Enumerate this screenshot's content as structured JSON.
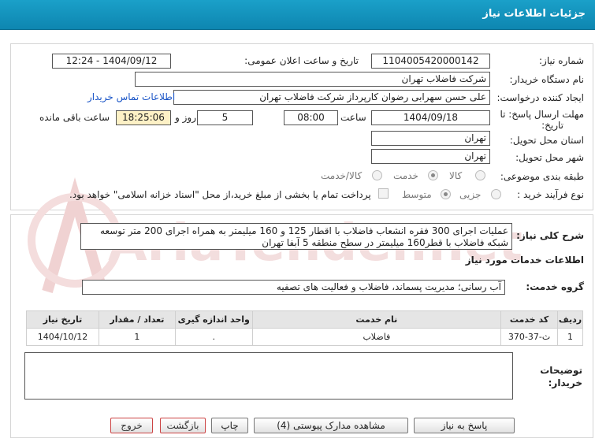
{
  "header": {
    "title": "جزئیات اطلاعات نیاز"
  },
  "form": {
    "need_number_label": "شماره نیاز:",
    "need_number": "1104005420000142",
    "announce_label": "تاریخ و ساعت اعلان عمومی:",
    "announce_value": "1404/09/12 - 12:24",
    "buyer_org_label": "نام دستگاه خریدار:",
    "buyer_org": "شرکت فاضلاب تهران",
    "creator_label": "ایجاد کننده درخواست:",
    "creator": "علی حسن  سهرابی رضوان کارپرداز شرکت فاضلاب تهران",
    "contact_link": "اطلاعات تماس خریدار",
    "deadline_label_1": "مهلت ارسال پاسخ: تا",
    "deadline_label_2": "تاریخ:",
    "deadline_date": "1404/09/18",
    "time_label": "ساعت",
    "deadline_time": "08:00",
    "days": "5",
    "days_label": "روز و",
    "remaining": "18:25:06",
    "remaining_label": "ساعت باقی مانده",
    "province_label": "استان محل تحویل:",
    "province": "تهران",
    "city_label": "شهر محل تحویل:",
    "city": "تهران",
    "category_label": "طبقه بندی موضوعی:",
    "category_options": [
      "کالا",
      "خدمت",
      "کالا/خدمت"
    ],
    "process_label": "نوع فرآیند خرید :",
    "process_options": [
      "جزیی",
      "متوسط"
    ],
    "payment_note": "پرداخت تمام یا بخشی از مبلغ خرید،از محل \"اسناد خزانه اسلامی\" خواهد بود."
  },
  "description": {
    "label": "شرح کلی نیاز:",
    "text": "عملیات اجرای 300 فقره انشعاب فاضلاب با اقطار 125 و 160 میلیمتر به همراه اجرای 200 متر توسعه شبکه فاضلاب با قطر160 میلیمتر در سطح منطقه 5 آبفا تهران"
  },
  "services": {
    "section_title": "اطلاعات خدمات مورد نیاز",
    "group_label": "گروه خدمت:",
    "group_value": "آب رسانی؛ مدیریت پسماند، فاضلاب و فعالیت های تصفیه",
    "columns": [
      "ردیف",
      "کد خدمت",
      "نام خدمت",
      "واحد اندازه گیری",
      "تعداد / مقدار",
      "تاریخ نیاز"
    ],
    "rows": [
      {
        "row": "1",
        "code": "ث-37-370",
        "name": "فاضلاب",
        "unit": ".",
        "qty": "1",
        "date": "1404/10/12"
      }
    ]
  },
  "buyer_notes": {
    "label_1": "توضیحات",
    "label_2": "خریدار:"
  },
  "buttons": {
    "reply": "پاسخ به نیاز",
    "docs": "مشاهده مدارک پیوستی (4)",
    "print": "چاپ",
    "back": "بازگشت",
    "exit": "خروج"
  },
  "watermark": {
    "text": "AriaTender.net"
  },
  "colors": {
    "header": "#1497c2",
    "highlight": "#fdf1c6",
    "link": "#1a55c7",
    "watermark": "#f2d6d6"
  }
}
